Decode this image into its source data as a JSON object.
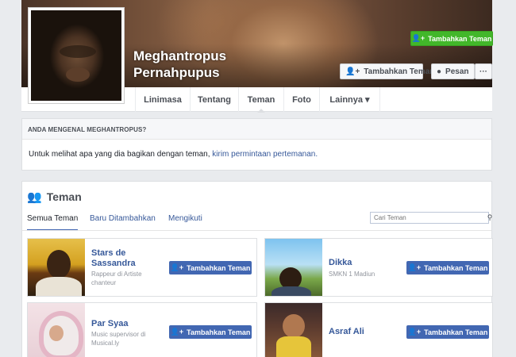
{
  "profile": {
    "name": "Meghantropus Pernahpupus",
    "add_friend_label": "Tambahkan Teman",
    "message_label": "Pesan",
    "more_label": "···"
  },
  "nav": {
    "tabs": [
      "Linimasa",
      "Tentang",
      "Teman",
      "Foto",
      "Lainnya ▾"
    ],
    "active": "Teman"
  },
  "know": {
    "heading": "ANDA MENGENAL MEGHANTROPUS?",
    "text_prefix": "Untuk melihat apa yang dia bagikan dengan teman,",
    "link_text": "kirim permintaan pertemanan.",
    "button_label": "Tambahkan Teman"
  },
  "friends": {
    "title": "Teman",
    "tabs": [
      "Semua Teman",
      "Baru Ditambahkan",
      "Mengikuti"
    ],
    "search_placeholder": "Cari Teman",
    "add_label": "Tambahkan Teman",
    "items": [
      {
        "name": "Stars de Sassandra",
        "subtitle": "Rappeur di Artiste chanteur"
      },
      {
        "name": "Dikka",
        "subtitle": "SMKN 1 Madiun"
      },
      {
        "name": "Par Syaa",
        "subtitle": "Music supervisor di Musical.ly"
      },
      {
        "name": "Asraf Ali",
        "subtitle": ""
      }
    ]
  },
  "colors": {
    "fb_blue": "#4267b2",
    "link_blue": "#365899",
    "green": "#42b72a",
    "background": "#e9ebee"
  },
  "icons": [
    "add-friend-icon",
    "message-icon",
    "friends-icon",
    "search-icon"
  ]
}
